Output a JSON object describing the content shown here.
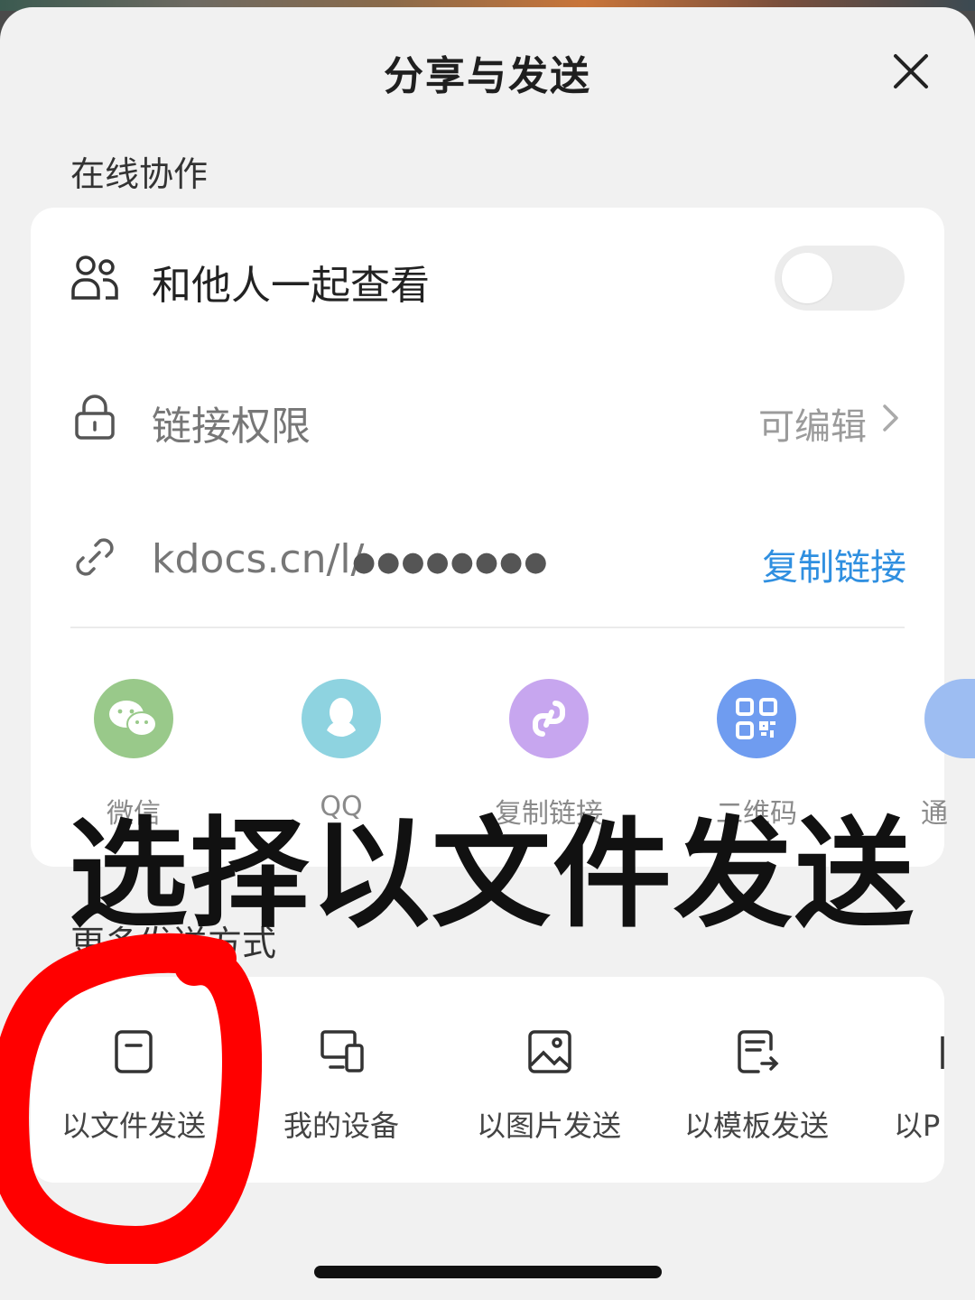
{
  "header": {
    "title": "分享与发送",
    "close_icon": "close-icon"
  },
  "online_collab": {
    "section_label": "在线协作",
    "view_together": {
      "label": "和他人一起查看",
      "icon": "people-icon",
      "toggle_on": false
    },
    "link_permission": {
      "label": "链接权限",
      "value": "可编辑",
      "icon": "lock-icon"
    },
    "link": {
      "url_prefix": "kdocs.cn/l/",
      "url_masked": "●●●●●●●●",
      "copy_label": "复制链接",
      "icon": "link-icon"
    },
    "share_targets": [
      {
        "label": "微信",
        "icon": "wechat-icon",
        "color": "#99c98a"
      },
      {
        "label": "QQ",
        "icon": "qq-icon",
        "color": "#8ed3e0"
      },
      {
        "label": "复制链接",
        "icon": "mini-link-icon",
        "color": "#c7a6ef"
      },
      {
        "label": "二维码",
        "icon": "qrcode-icon",
        "color": "#6f9cf0"
      },
      {
        "label": "通",
        "icon": "contact-icon",
        "color": "#9dbdf2"
      }
    ]
  },
  "annotation": {
    "overlay_text": "选择以文件发送",
    "highlight_color": "#ff0000"
  },
  "more_send": {
    "section_label": "更多发送方式",
    "items": [
      {
        "label": "以文件发送",
        "icon": "file-icon"
      },
      {
        "label": "我的设备",
        "icon": "devices-icon"
      },
      {
        "label": "以图片发送",
        "icon": "image-icon"
      },
      {
        "label": "以模板发送",
        "icon": "template-icon"
      },
      {
        "label": "以P",
        "icon": "pdf-icon"
      }
    ]
  }
}
